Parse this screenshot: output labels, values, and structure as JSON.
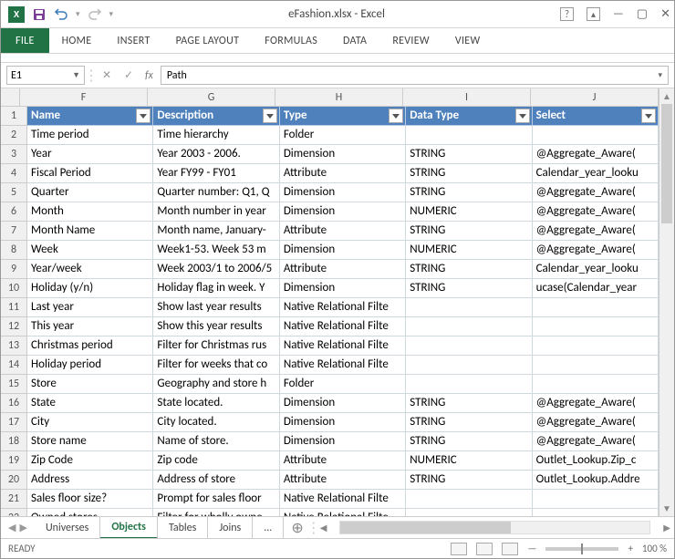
{
  "title": "eFashion.xlsx - Excel",
  "ribbon_tabs": [
    "FILE",
    "HOME",
    "INSERT",
    "PAGE LAYOUT",
    "FORMULAS",
    "DATA",
    "REVIEW",
    "VIEW"
  ],
  "namebox": "E1",
  "formula_value": "Path",
  "columns": {
    "letters": [
      "F",
      "G",
      "H",
      "I",
      "J"
    ],
    "widths": [
      140,
      140,
      140,
      140,
      140
    ],
    "headers": [
      "Name",
      "Description",
      "Type",
      "Data Type",
      "Select"
    ]
  },
  "rows": [
    {
      "n": 2,
      "c": [
        "Time period",
        "Time hierarchy",
        "Folder",
        "",
        ""
      ]
    },
    {
      "n": 3,
      "c": [
        "Year",
        "Year 2003 - 2006.",
        "Dimension",
        "STRING",
        "@Aggregate_Aware("
      ]
    },
    {
      "n": 4,
      "c": [
        "Fiscal Period",
        "Year FY99 - FY01",
        "Attribute",
        "STRING",
        "Calendar_year_looku"
      ]
    },
    {
      "n": 5,
      "c": [
        "Quarter",
        "Quarter number: Q1, Q",
        "Dimension",
        "STRING",
        "@Aggregate_Aware("
      ]
    },
    {
      "n": 6,
      "c": [
        "Month",
        "Month number in year",
        "Dimension",
        "NUMERIC",
        "@Aggregate_Aware("
      ]
    },
    {
      "n": 7,
      "c": [
        "Month Name",
        "Month name, January-",
        "Attribute",
        "STRING",
        "@Aggregate_Aware("
      ]
    },
    {
      "n": 8,
      "c": [
        "Week",
        "Week1-53. Week 53 m",
        "Dimension",
        "NUMERIC",
        "@Aggregate_Aware("
      ]
    },
    {
      "n": 9,
      "c": [
        "Year/week",
        "Week 2003/1 to 2006/5",
        "Attribute",
        "STRING",
        "Calendar_year_looku"
      ]
    },
    {
      "n": 10,
      "c": [
        "Holiday (y/n)",
        "Holiday flag in week. Y",
        "Dimension",
        "STRING",
        "ucase(Calendar_year"
      ]
    },
    {
      "n": 11,
      "c": [
        "Last year",
        "Show last year results",
        "Native Relational Filte",
        "",
        ""
      ]
    },
    {
      "n": 12,
      "c": [
        "This year",
        "Show this year results",
        "Native Relational Filte",
        "",
        ""
      ]
    },
    {
      "n": 13,
      "c": [
        "Christmas period",
        "Filter for Christmas rus",
        "Native Relational Filte",
        "",
        ""
      ]
    },
    {
      "n": 14,
      "c": [
        "Holiday period",
        "Filter for weeks that co",
        "Native Relational Filte",
        "",
        ""
      ]
    },
    {
      "n": 15,
      "c": [
        "Store",
        "Geography and store h",
        "Folder",
        "",
        ""
      ]
    },
    {
      "n": 16,
      "c": [
        "State",
        "State located.",
        "Dimension",
        "STRING",
        "@Aggregate_Aware("
      ]
    },
    {
      "n": 17,
      "c": [
        "City",
        "City located.",
        "Dimension",
        "STRING",
        "@Aggregate_Aware("
      ]
    },
    {
      "n": 18,
      "c": [
        "Store name",
        "Name of store.",
        "Dimension",
        "STRING",
        "@Aggregate_Aware("
      ]
    },
    {
      "n": 19,
      "c": [
        "Zip Code",
        "Zip code",
        "Attribute",
        "NUMERIC",
        "Outlet_Lookup.Zip_c"
      ]
    },
    {
      "n": 20,
      "c": [
        "Address",
        "Address of store",
        "Attribute",
        "STRING",
        "Outlet_Lookup.Addre"
      ]
    },
    {
      "n": 21,
      "c": [
        "Sales floor size?",
        "Prompt for sales floor",
        "Native Relational Filte",
        "",
        ""
      ]
    },
    {
      "n": 22,
      "c": [
        "Owned stores",
        "Filter for wholly owne",
        "Native Relational Filte",
        "",
        ""
      ]
    }
  ],
  "sheet_tabs": [
    "Universes",
    "Objects",
    "Tables",
    "Joins",
    "..."
  ],
  "active_sheet": "Objects",
  "status_left": "READY",
  "zoom": "100 %"
}
